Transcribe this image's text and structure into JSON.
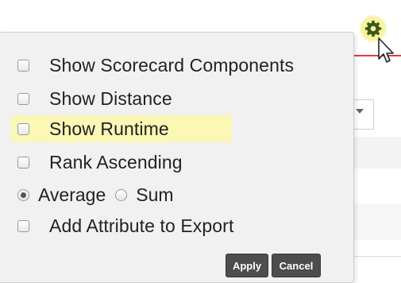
{
  "settings_menu": {
    "options": [
      {
        "label": "Show Scorecard Components",
        "checked": false
      },
      {
        "label": "Show Distance",
        "checked": false
      },
      {
        "label": "Show Runtime",
        "checked": false,
        "highlighted": true
      },
      {
        "label": "Rank Ascending",
        "checked": false
      },
      {
        "label": "Add Attribute to Export",
        "checked": false
      }
    ],
    "aggregation": {
      "options": [
        {
          "label": "Average",
          "selected": true
        },
        {
          "label": "Sum",
          "selected": false
        }
      ]
    },
    "buttons": {
      "apply": "Apply",
      "cancel": "Cancel"
    }
  },
  "icons": {
    "settings": "gear-icon",
    "pointer": "mouse-cursor-icon"
  },
  "colors": {
    "gear": "#3a5a1a",
    "gear_highlight": "#fff98c",
    "row_highlight": "#fbf7b5",
    "accent_line": "#e03a3a",
    "button_bg": "#4d4d4d",
    "popup_bg": "#f1f1f1"
  }
}
